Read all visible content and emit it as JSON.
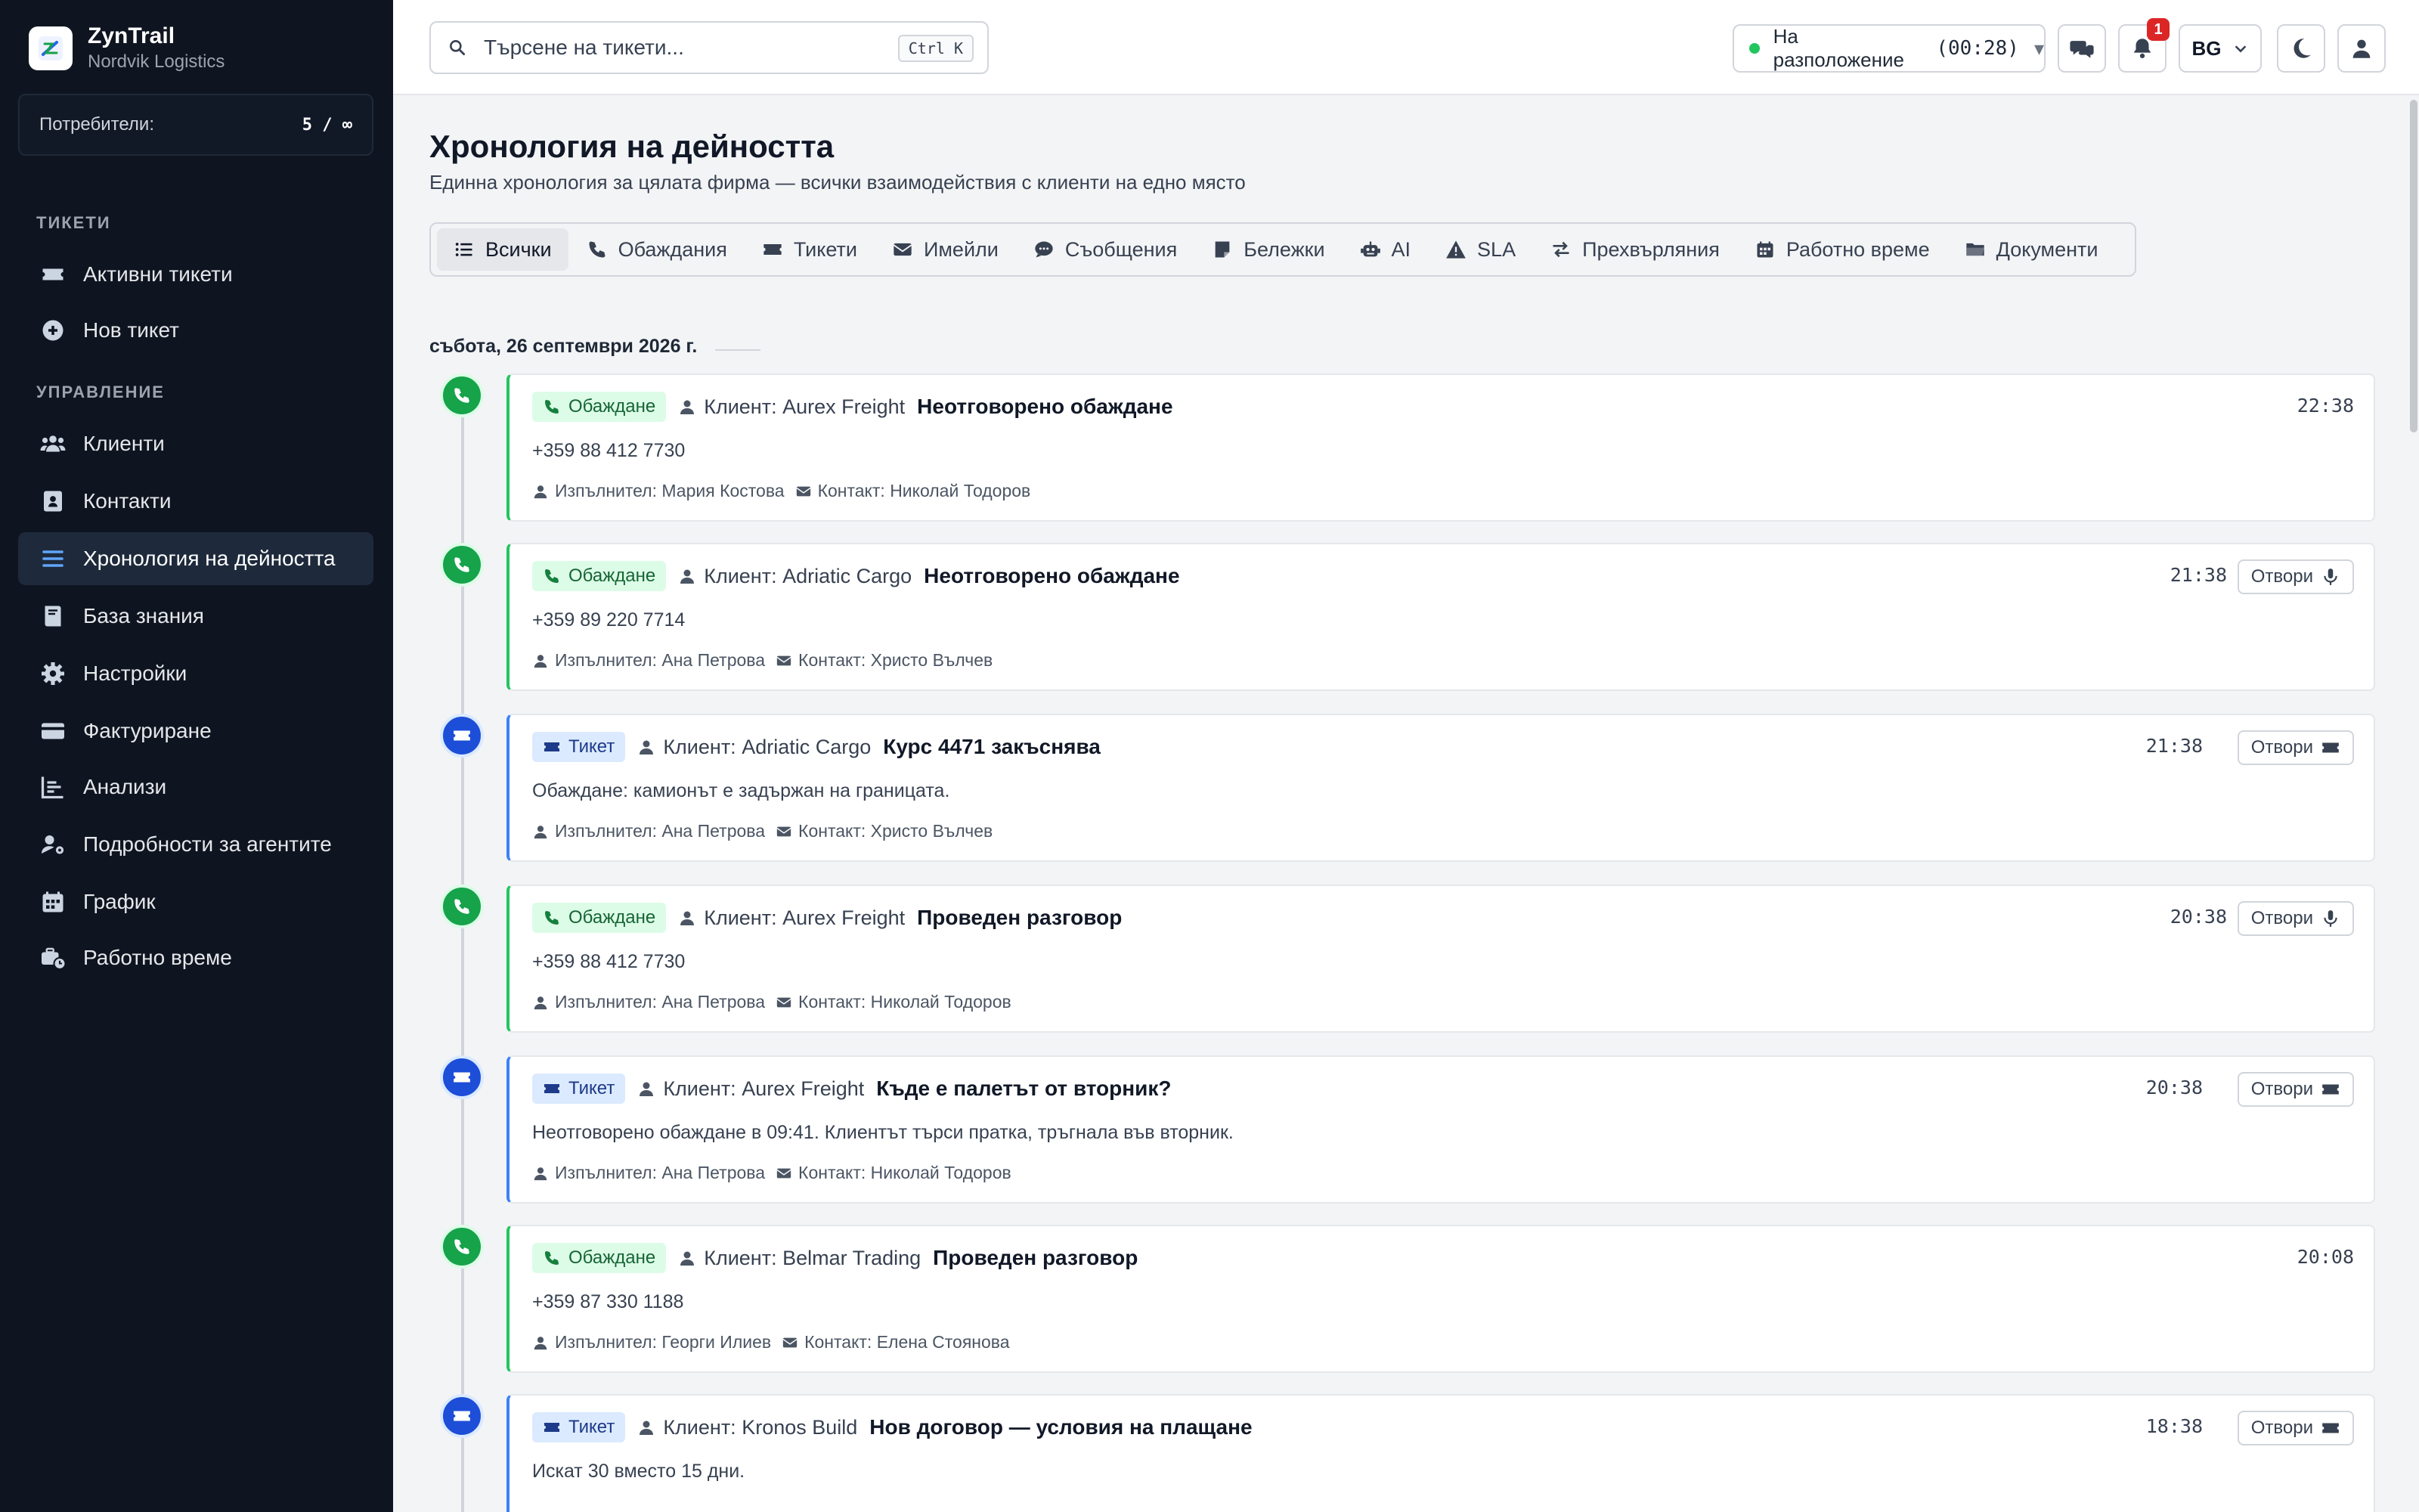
{
  "brand": {
    "name": "ZynTrail",
    "company": "Nordvik Logistics"
  },
  "users": {
    "label": "Потребители:",
    "value": "5 / ∞"
  },
  "sidebar": {
    "sections": [
      {
        "title": "ТИКЕТИ"
      },
      {
        "title": "УПРАВЛЕНИЕ"
      }
    ],
    "items": [
      {
        "label": "Активни тикети",
        "icon": "ticket-icon"
      },
      {
        "label": "Нов тикет",
        "icon": "plus-circle-icon"
      },
      {
        "label": "Клиенти",
        "icon": "users-icon"
      },
      {
        "label": "Контакти",
        "icon": "contact-book-icon"
      },
      {
        "label": "Хронология на дейността",
        "icon": "list-icon",
        "active": true
      },
      {
        "label": "База знания",
        "icon": "book-icon"
      },
      {
        "label": "Настройки",
        "icon": "gear-icon"
      },
      {
        "label": "Фактуриране",
        "icon": "credit-card-icon"
      },
      {
        "label": "Анализи",
        "icon": "chart-icon"
      },
      {
        "label": "Подробности за агентите",
        "icon": "user-gear-icon"
      },
      {
        "label": "График",
        "icon": "calendar-icon"
      },
      {
        "label": "Работно време",
        "icon": "business-time-icon"
      }
    ]
  },
  "topbar": {
    "search_placeholder": "Търсене на тикети...",
    "search_shortcut": "Ctrl K",
    "status_label": "На разположение",
    "status_timer": "(00:28)",
    "status_caret": "▾",
    "notification_count": "1",
    "language": "BG"
  },
  "page": {
    "title": "Хронология на дейността",
    "subtitle": "Единна хронология за цялата фирма — всички взаимодействия с клиенти на едно място"
  },
  "tabs": [
    {
      "label": "Всички",
      "icon": "list-icon",
      "active": true
    },
    {
      "label": "Обаждания",
      "icon": "phone-icon"
    },
    {
      "label": "Тикети",
      "icon": "ticket-icon"
    },
    {
      "label": "Имейли",
      "icon": "envelope-icon"
    },
    {
      "label": "Съобщения",
      "icon": "comment-icon"
    },
    {
      "label": "Бележки",
      "icon": "note-icon"
    },
    {
      "label": "AI",
      "icon": "robot-icon"
    },
    {
      "label": "SLA",
      "icon": "warning-icon"
    },
    {
      "label": "Прехвърляния",
      "icon": "transfer-icon"
    },
    {
      "label": "Работно време",
      "icon": "calendar-icon"
    },
    {
      "label": "Документи",
      "icon": "folder-icon"
    }
  ],
  "date_heading": "събота, 26 септември 2026 г.",
  "events": [
    {
      "type": "call",
      "tag": "Обаждане",
      "client": "Клиент: Aurex Freight",
      "title": "Неотговорено обаждане",
      "detail": "+359 88 412 7730",
      "performer": "Изпълнител: Мария Костова",
      "contact": "Контакт: Николай Тодоров",
      "time": "22:38",
      "open_label": ""
    },
    {
      "type": "call",
      "tag": "Обаждане",
      "client": "Клиент: Adriatic Cargo",
      "title": "Неотговорено обаждане",
      "detail": "+359 89 220 7714",
      "performer": "Изпълнител: Ана Петрова",
      "contact": "Контакт: Христо Вълчев",
      "time": "21:38",
      "open_label": "Отвори"
    },
    {
      "type": "ticket",
      "tag": "Тикет",
      "client": "Клиент: Adriatic Cargo",
      "title": "Курс 4471 закъснява",
      "detail": "Обаждане: камионът е задържан на границата.",
      "performer": "Изпълнител: Ана Петрова",
      "contact": "Контакт: Христо Вълчев",
      "time": "21:38",
      "open_label": "Отвори"
    },
    {
      "type": "call",
      "tag": "Обаждане",
      "client": "Клиент: Aurex Freight",
      "title": "Проведен разговор",
      "detail": "+359 88 412 7730",
      "performer": "Изпълнител: Ана Петрова",
      "contact": "Контакт: Николай Тодоров",
      "time": "20:38",
      "open_label": "Отвори"
    },
    {
      "type": "ticket",
      "tag": "Тикет",
      "client": "Клиент: Aurex Freight",
      "title": "Къде е палетът от вторник?",
      "detail": "Неотговорено обаждане в 09:41. Клиентът търси пратка, тръгнала във вторник.",
      "performer": "Изпълнител: Ана Петрова",
      "contact": "Контакт: Николай Тодоров",
      "time": "20:38",
      "open_label": "Отвори"
    },
    {
      "type": "call",
      "tag": "Обаждане",
      "client": "Клиент: Belmar Trading",
      "title": "Проведен разговор",
      "detail": "+359 87 330 1188",
      "performer": "Изпълнител: Георги Илиев",
      "contact": "Контакт: Елена Стоянова",
      "time": "20:08",
      "open_label": ""
    },
    {
      "type": "ticket",
      "tag": "Тикет",
      "client": "Клиент: Kronos Build",
      "title": "Нов договор — условия на плащане",
      "detail": "Искат 30 вместо 15 дни.",
      "performer": "",
      "contact": "",
      "time": "18:38",
      "open_label": "Отвори"
    }
  ],
  "colors": {
    "sidebar_bg": "#0f1520",
    "call_accent": "#16a34a",
    "ticket_accent": "#1d4ed8",
    "badge": "#dc2626"
  }
}
